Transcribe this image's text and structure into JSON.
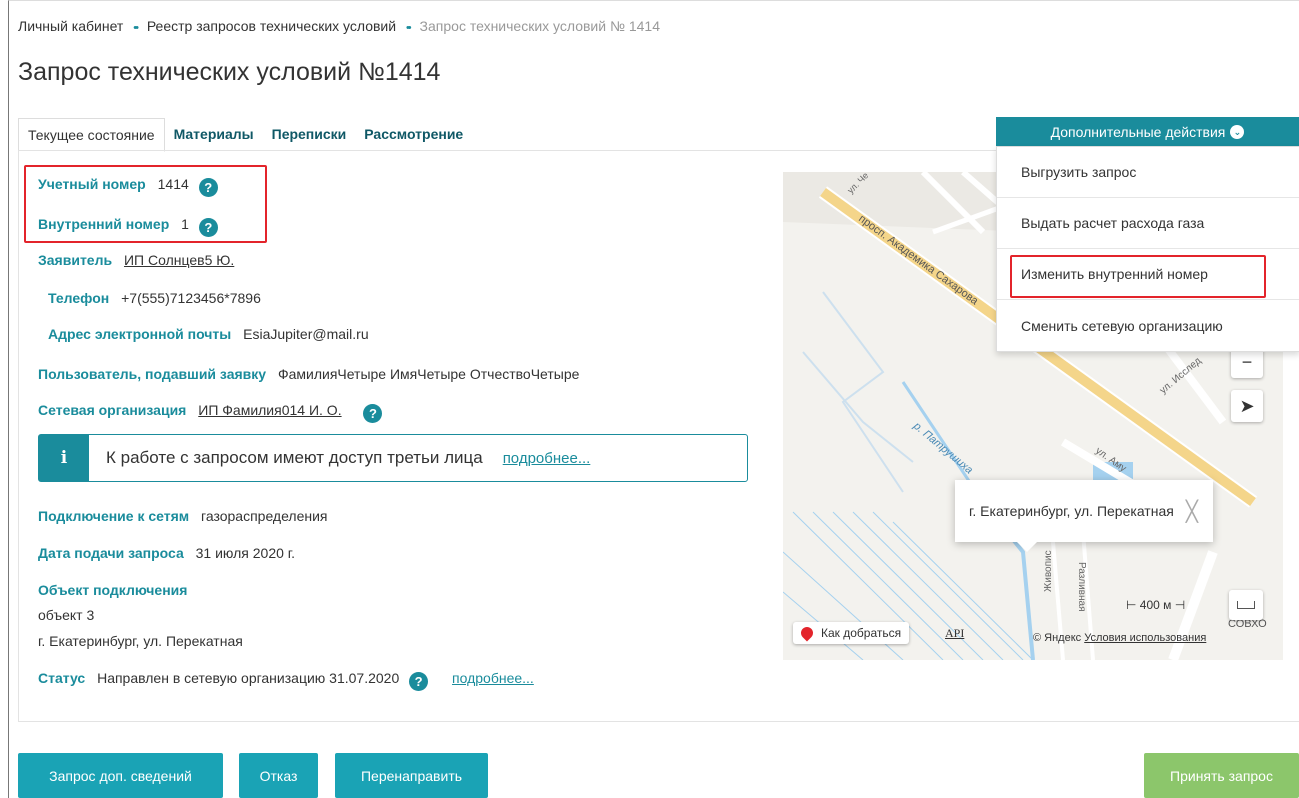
{
  "breadcrumb": {
    "items": [
      "Личный кабинет",
      "Реестр запросов технических условий"
    ],
    "separator": "••",
    "current": "Запрос технических условий № 1414"
  },
  "page_title": "Запрос технических условий №1414",
  "tabs": [
    {
      "label": "Текущее состояние",
      "active": true
    },
    {
      "label": "Материалы",
      "active": false
    },
    {
      "label": "Переписки",
      "active": false
    },
    {
      "label": "Рассмотрение",
      "active": false
    }
  ],
  "fields": {
    "account_number": {
      "label": "Учетный номер",
      "value": "1414"
    },
    "internal_number": {
      "label": "Внутренний номер",
      "value": "1"
    },
    "applicant": {
      "label": "Заявитель",
      "value": "ИП Солнцев5 Ю."
    },
    "phone": {
      "label": "Телефон",
      "value": "+7(555)7123456*7896"
    },
    "email": {
      "label": "Адрес электронной почты",
      "value": "EsiaJupiter@mail.ru"
    },
    "submitter": {
      "label": "Пользователь, подавший заявку",
      "value": "ФамилияЧетыре ИмяЧетыре ОтчествоЧетыре"
    },
    "network_org": {
      "label": "Сетевая организация",
      "value": "ИП Фамилия014 И. О."
    },
    "connection": {
      "label": "Подключение к сетям",
      "value": "газораспределения"
    },
    "submit_date": {
      "label": "Дата подачи запроса",
      "value": "31 июля 2020 г."
    },
    "object": {
      "label": "Объект подключения",
      "name": "объект 3",
      "address": "г. Екатеринбург, ул. Перекатная"
    },
    "status": {
      "label": "Статус",
      "value": "Направлен в сетевую организацию 31.07.2020",
      "link": "подробнее..."
    }
  },
  "info_box": {
    "icon": "i",
    "text": "К работе с запросом имеют доступ третьи лица",
    "link": "подробнее..."
  },
  "help_icon": "?",
  "map": {
    "popup_text": "г. Екатеринбург, ул. Перекатная",
    "popup_close": "╳",
    "route_label": "Как добраться",
    "api_label": "API",
    "copyright": "© Яндекс",
    "terms_label": "Условия использования",
    "scale_label": "400 м",
    "street_labels": [
      "ул. Че",
      "просп. Академика Сахарова",
      "ул. Исслед",
      "р. Патрушиха",
      "ул. Аму",
      "Живопис",
      "Разливная",
      "СОВХО"
    ],
    "zoom_out": "−",
    "locate_icon": "➤",
    "ruler_icon": "ruler-icon"
  },
  "actions": {
    "button_label": "Дополнительные действия",
    "chevron": "⌄",
    "menu": [
      "Выгрузить запрос",
      "Выдать расчет расхода газа",
      "Изменить внутренний номер",
      "Сменить сетевую организацию"
    ]
  },
  "buttons": {
    "request_info": "Запрос доп. сведений",
    "reject": "Отказ",
    "redirect": "Перенаправить",
    "accept": "Принять запрос"
  },
  "colors": {
    "accent": "#1a8c9c",
    "button": "#1aa3b5",
    "accept": "#8cc66b",
    "highlight": "#e3242b"
  }
}
